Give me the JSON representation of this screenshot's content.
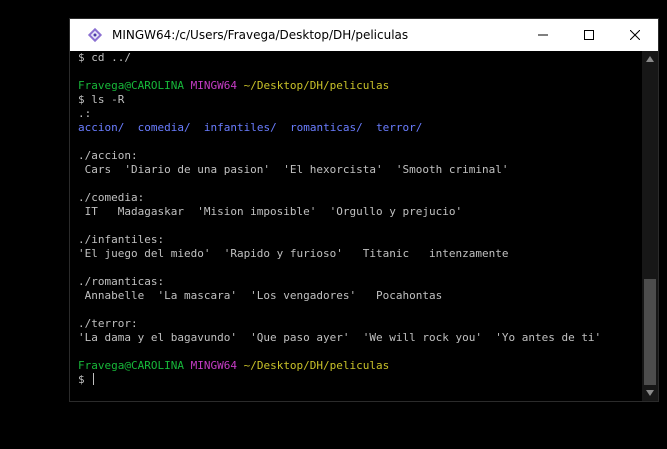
{
  "window": {
    "title": "MINGW64:/c/Users/Fravega/Desktop/DH/peliculas"
  },
  "terminal": {
    "cd_command": "$ cd ../",
    "prompt1": {
      "user_host": "Fravega@CAROLINA",
      "env": "MINGW64",
      "path": "~/Desktop/DH/peliculas"
    },
    "ls_command": "$ ls -R",
    "root_label": ".:",
    "root_dirs": [
      "accion/",
      "comedia/",
      "infantiles/",
      "romanticas/",
      "terror/"
    ],
    "sections": [
      {
        "header": "./accion:",
        "items": " Cars  'Diario de una pasion'  'El hexorcista'  'Smooth criminal'"
      },
      {
        "header": "./comedia:",
        "items": " IT   Madagaskar  'Mision imposible'  'Orgullo y prejucio'"
      },
      {
        "header": "./infantiles:",
        "items": "'El juego del miedo'  'Rapido y furioso'   Titanic   intenzamente"
      },
      {
        "header": "./romanticas:",
        "items": " Annabelle  'La mascara'  'Los vengadores'   Pocahontas"
      },
      {
        "header": "./terror:",
        "items": "'La dama y el bagavundo'  'Que paso ayer'  'We will rock you'  'Yo antes de ti'"
      }
    ],
    "prompt2": {
      "user_host": "Fravega@CAROLINA",
      "env": "MINGW64",
      "path": "~/Desktop/DH/peliculas"
    },
    "input_prompt": "$ "
  },
  "colors": {
    "user_host": "#17b83a",
    "env": "#c53cc5",
    "path": "#c9c229",
    "dirs": "#6a7dff",
    "text": "#c0c0c0"
  },
  "icons": {
    "app": "git-bash-diamond-icon",
    "minimize": "minimize-icon",
    "maximize": "maximize-icon",
    "close": "close-icon"
  }
}
